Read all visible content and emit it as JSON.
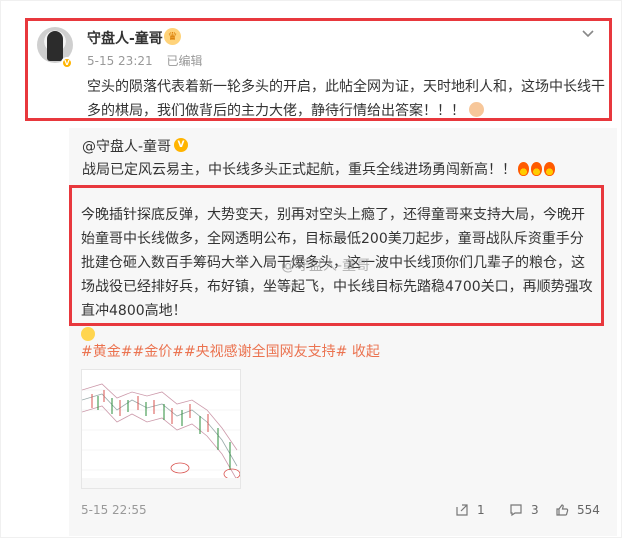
{
  "post": {
    "author": "守盘人-童哥",
    "time": "5-15 23:21",
    "edited": "已编辑",
    "text": "空头的陨落代表着新一轮多头的开启，此帖全网为证，天时地利人和，这场中长线干多的棋局，我们做背后的主力大佬，静待行情给出答案！！！"
  },
  "repost": {
    "author": "@守盘人-童哥",
    "line1": "战局已定风云易主，中长线多头正式起航，重兵全线进场勇闯新高！！",
    "body": "今晚插针探底反弹，大势变天，别再对空头上瘾了，还得童哥来支持大局，今晚开始童哥中长线做多，全网透明公布，目标最低200美刀起步，童哥战队斥资重手分批建仓砸入数百手筹码大举入局干爆多头，这一波中长线顶你们几辈子的粮仓，这场战役已经排好兵，布好镇，坐等起飞，中长线目标先踏稳4700关口，再顺势强攻直冲4800高地！",
    "watermark": "@守盘人-童哥",
    "tags": [
      "#黄金#",
      "#金价#",
      "#央视感谢全国网友支持#"
    ],
    "collapse": "收起",
    "time": "5-15 22:55",
    "shares": "1",
    "comments": "3",
    "likes": "554"
  },
  "colors": {
    "highlight": "#e8383d",
    "link": "#eb7350",
    "meta": "#999999"
  }
}
